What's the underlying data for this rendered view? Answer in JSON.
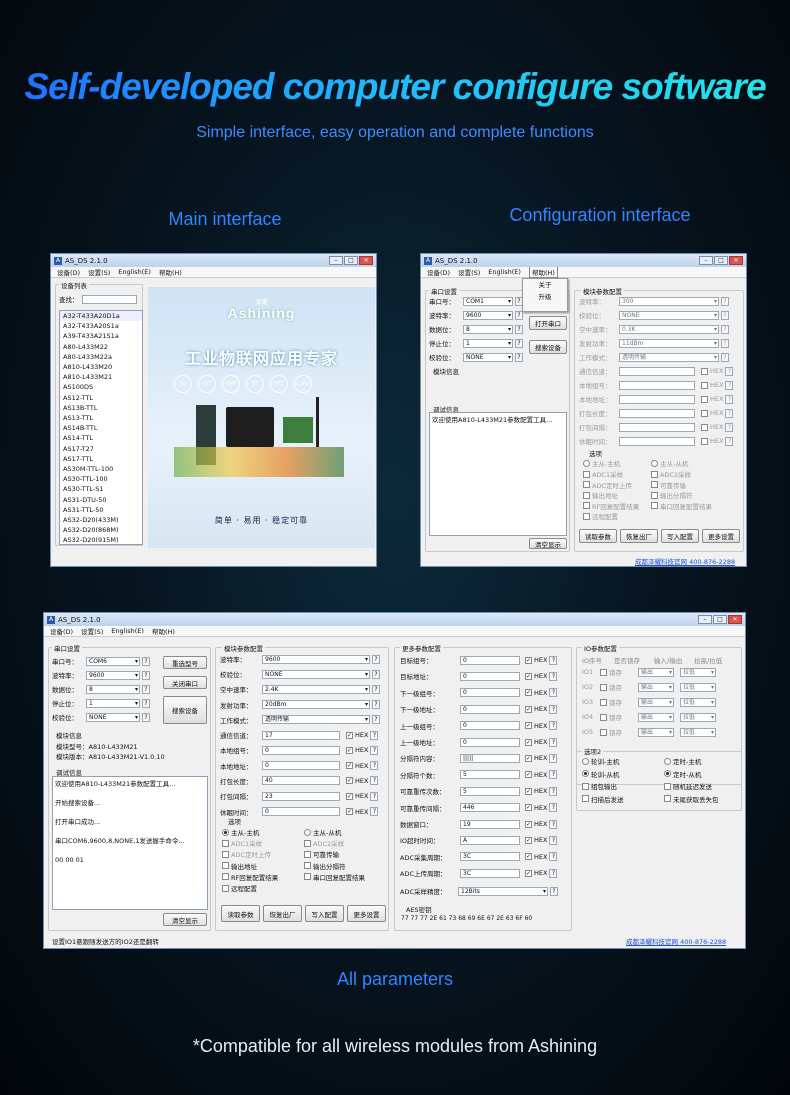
{
  "header": {
    "title": "Self-developed computer configure software",
    "subtitle": "Simple interface, easy operation and complete functions"
  },
  "labels": {
    "main": "Main interface",
    "config": "Configuration interface",
    "all": "All parameters"
  },
  "footer": "*Compatible for all wireless modules from Ashining",
  "app": {
    "title": "AS_DS 2.1.0",
    "menus": [
      "设备(D)",
      "设置(S)",
      "English(E)",
      "帮助(H)"
    ],
    "link": "成都泽耀科技官网 400-876-2288"
  },
  "main": {
    "group": "设备列表",
    "search_label": "查找：",
    "devices": [
      "A32-T433A20D1a",
      "A32-T433A20S1a",
      "A39-T433A21S1a",
      "A80-L433M22",
      "A80-L433M22a",
      "A810-L433M20",
      "A810-L433M21",
      "AS100DS",
      "AS12-TTL",
      "AS13B-TTL",
      "AS13-TTL",
      "AS14B-TTL",
      "AS14-TTL",
      "AS17-T27",
      "AS17-TTL",
      "AS30M-TTL-100",
      "AS30-TTL-100",
      "AS30-TTL-S1",
      "AS31-DTU-50",
      "AS31-TTL-50",
      "AS32-D20(433M)",
      "AS32-D20(868M)",
      "AS32-D20(915M)"
    ],
    "brand": "Ashining",
    "brand_small": "泽耀",
    "slogan": "工业物联网应用专家",
    "tagline": "简单 · 易用 · 稳定可靠",
    "icon_labels": [
      "4G",
      "IOT",
      "WiFi",
      "BT",
      "NFC",
      "LoRa"
    ]
  },
  "config": {
    "serial_group": "串口设置",
    "serial_labels": [
      "串口号：",
      "波特率：",
      "数据位：",
      "停止位：",
      "校验位："
    ],
    "serial_values": [
      "COM1",
      "9600",
      "8",
      "1",
      "NONE"
    ],
    "help_menu": [
      "关于",
      "升级"
    ],
    "open_btn": "打开串口",
    "search_btn": "搜索设备",
    "module_info": "模块信息",
    "debug_info": "调试信息",
    "debug_text": "欢迎使用A810-L433M21参数配置工具...",
    "clear_btn": "清空显示",
    "param_group": "模块参数配置",
    "params": [
      {
        "label": "波特率：",
        "value": "300"
      },
      {
        "label": "校验位：",
        "value": "NONE"
      },
      {
        "label": "空中速率：",
        "value": "0.3K"
      },
      {
        "label": "发射功率：",
        "value": "11dBm"
      },
      {
        "label": "工作模式：",
        "value": "透明传输"
      }
    ],
    "hex_rows": [
      "通信信道：",
      "本地组号：",
      "本地地址：",
      "打包长度：",
      "打包间隔：",
      "休眠时间："
    ],
    "options_title": "选项",
    "radio": [
      "主从-主机",
      "主从-从机"
    ],
    "checks": [
      [
        "ADC1采样",
        "ADC2采样"
      ],
      [
        "ADC定时上传",
        "可靠传输"
      ],
      [
        "输出地址",
        "输出分隔符"
      ],
      [
        "RF回复配置结果",
        "串口回复配置结果"
      ],
      [
        "远程配置",
        ""
      ]
    ],
    "buttons": [
      "读取参数",
      "恢复出厂",
      "写入配置",
      "更多设置"
    ]
  },
  "full": {
    "serial_values": [
      "COM6",
      "9600",
      "8",
      "1",
      "NONE"
    ],
    "btn_model": "重选型号",
    "btn_close": "关闭串口",
    "btn_search": "搜索设备",
    "model": "模块型号：A810-L433M21",
    "version": "模块版本：A810-L433M21-V1.0.10",
    "debug": [
      "欢迎使用A810-L433M21参数配置工具...",
      "开始搜索设备...",
      "打开串口成功...",
      "串口COM6,9600,8,NONE,1发送握手命令...",
      "00 00 01"
    ],
    "params": [
      {
        "label": "波特率：",
        "value": "9600"
      },
      {
        "label": "校验位：",
        "value": "NONE"
      },
      {
        "label": "空中速率：",
        "value": "2.4K"
      },
      {
        "label": "发射功率：",
        "value": "20dBm"
      },
      {
        "label": "工作模式：",
        "value": "透明传输"
      }
    ],
    "hex": [
      {
        "label": "通信信道：",
        "value": "17"
      },
      {
        "label": "本地组号：",
        "value": "0"
      },
      {
        "label": "本地地址：",
        "value": "0"
      },
      {
        "label": "打包长度：",
        "value": "40"
      },
      {
        "label": "打包间隔：",
        "value": "23"
      },
      {
        "label": "休眠时间：",
        "value": "0"
      }
    ],
    "more_group": "更多参数配置",
    "more": [
      {
        "label": "目标组号：",
        "value": "0"
      },
      {
        "label": "目标地址：",
        "value": "0"
      },
      {
        "label": "下一级组号：",
        "value": "0"
      },
      {
        "label": "下一级地址：",
        "value": "0"
      },
      {
        "label": "上一级组号：",
        "value": "0"
      },
      {
        "label": "上一级地址：",
        "value": "0"
      },
      {
        "label": "分隔符内容：",
        "value": "|||||"
      },
      {
        "label": "分隔符个数：",
        "value": "5"
      },
      {
        "label": "可靠重传次数：",
        "value": "5"
      },
      {
        "label": "可靠重传间隔：",
        "value": "446"
      },
      {
        "label": "数据窗口：",
        "value": "19"
      },
      {
        "label": "IO超时时间：",
        "value": "A"
      },
      {
        "label": "ADC采集周期：",
        "value": "3C"
      },
      {
        "label": "ADC上传周期：",
        "value": "3C"
      }
    ],
    "adc_label": "ADC采样精度：",
    "adc_value": "12Bits",
    "aes_label": "AES密钥",
    "aes_value": "77 77 77 2E 61 73 68 69 6E 67 2E 63 6F 60",
    "io_group": "IO参数配置",
    "io_headers": [
      "IO序号",
      "是否锁存",
      "输入/输出",
      "拉高/拉低"
    ],
    "io_rows": [
      "IO1",
      "IO2",
      "IO3",
      "IO4",
      "IO5"
    ],
    "io_lock": "锁存",
    "io_dir": "输出",
    "io_pull": "拉低",
    "opt2": "选项2",
    "opt2_items": [
      [
        "轮训-主机",
        "定时-主机"
      ],
      [
        "轮训-从机",
        "定时-从机"
      ],
      [
        "组包输出",
        "随机延迟发送"
      ],
      [
        "扫描后发送",
        "未尾获取丢失包"
      ]
    ],
    "status": "设置IO1悬跟随发送方的IO2还是翻转"
  }
}
